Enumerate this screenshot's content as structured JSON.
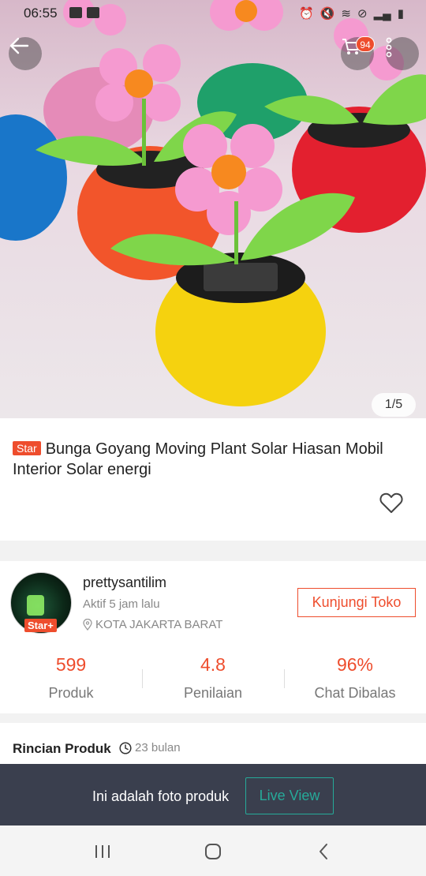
{
  "status_bar": {
    "time": "06:55"
  },
  "header": {
    "cart_count": "94",
    "image_counter": "1/5"
  },
  "product": {
    "badge": "Star",
    "title": "Bunga Goyang Moving Plant Solar Hiasan Mobil Interior Solar energi"
  },
  "shop": {
    "name": "prettysantilim",
    "badge": "Star+",
    "active_status": "Aktif 5 jam lalu",
    "location": "KOTA JAKARTA BARAT",
    "visit_label": "Kunjungi Toko",
    "stats": [
      {
        "value": "599",
        "label": "Produk"
      },
      {
        "value": "4.8",
        "label": "Penilaian"
      },
      {
        "value": "96%",
        "label": "Chat Dibalas"
      }
    ]
  },
  "details": {
    "title": "Rincian Produk",
    "time": "23 bulan"
  },
  "live_bar": {
    "text": "Ini adalah foto produk",
    "button_label": "Live View"
  },
  "colors": {
    "accent": "#ee4d2d",
    "teal": "#26aa99",
    "dark_bar": "#3a3f4e"
  },
  "icons": [
    "back-arrow-icon",
    "cart-icon",
    "more-vertical-icon",
    "heart-icon",
    "location-pin-icon",
    "clock-icon",
    "recent-apps-icon",
    "home-icon",
    "back-icon"
  ]
}
